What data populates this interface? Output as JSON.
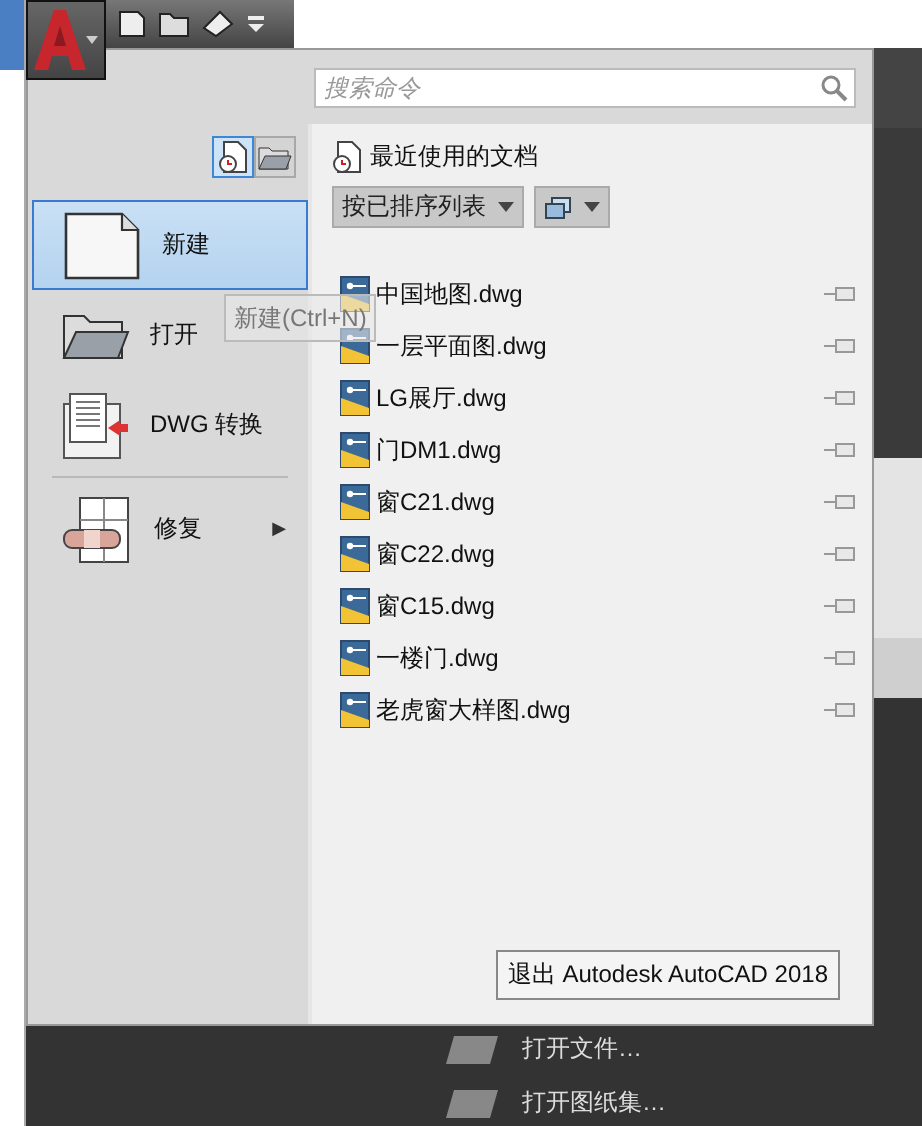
{
  "search": {
    "placeholder": "搜索命令"
  },
  "view_toggle": [
    {
      "kind": "recent",
      "selected": true
    },
    {
      "kind": "open",
      "selected": false
    }
  ],
  "menu_groups": [
    [
      {
        "kind": "new",
        "label": "新建",
        "selected": true
      },
      {
        "kind": "open",
        "label": "打开",
        "selected": false
      },
      {
        "kind": "convert",
        "label": "DWG 转换",
        "selected": false
      }
    ],
    [
      {
        "kind": "repair",
        "label": "修复",
        "selected": false,
        "arrow": "▶"
      }
    ]
  ],
  "tooltip": "新建(Ctrl+N)",
  "recent": {
    "title": "最近使用的文档",
    "sort": "按已排序列表",
    "files": [
      {
        "name": "中国地图.dwg"
      },
      {
        "name": "一层平面图.dwg"
      },
      {
        "name": "LG展厅.dwg"
      },
      {
        "name": "门DM1.dwg"
      },
      {
        "name": "窗C21.dwg"
      },
      {
        "name": "窗C22.dwg"
      },
      {
        "name": "窗C15.dwg"
      },
      {
        "name": "一楼门.dwg"
      },
      {
        "name": "老虎窗大样图.dwg"
      }
    ]
  },
  "exit_button": "退出 Autodesk AutoCAD 2018",
  "background_items": [
    "打开文件…",
    "打开图纸集…"
  ]
}
